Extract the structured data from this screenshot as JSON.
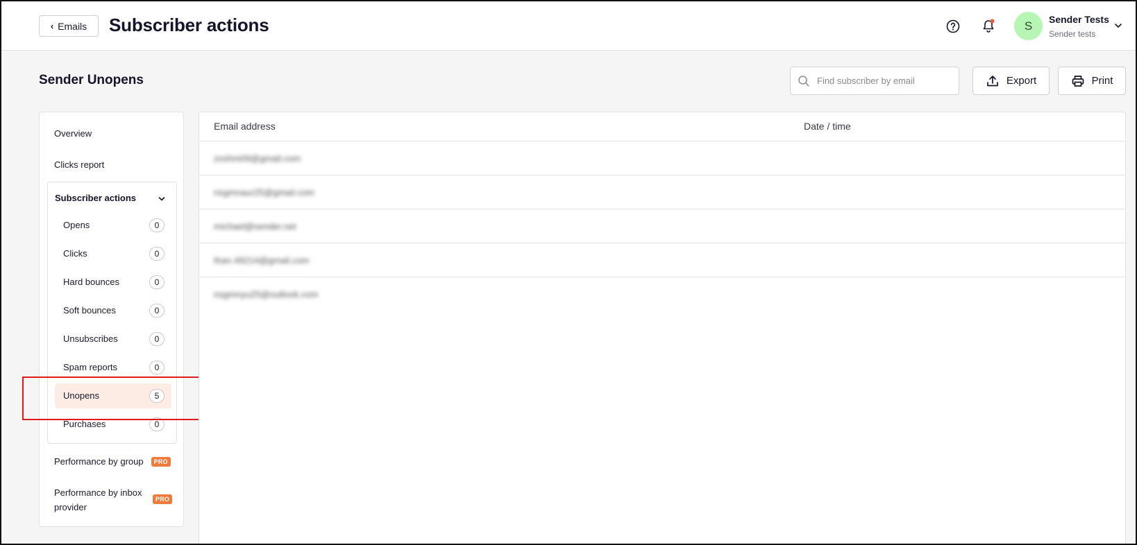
{
  "header": {
    "back_label": "Emails",
    "title": "Subscriber actions",
    "help_icon": "help-circle-icon",
    "notification_icon": "bell-icon",
    "notification_dot_color": "#f05a3a",
    "account": {
      "avatar_letter": "S",
      "name": "Sender Tests",
      "subtitle": "Sender tests"
    }
  },
  "section": {
    "title": "Sender Unopens",
    "search_placeholder": "Find subscriber by email",
    "export_label": "Export",
    "print_label": "Print"
  },
  "sidebar": {
    "overview": "Overview",
    "clicks_report": "Clicks report",
    "group_title": "Subscriber actions",
    "items": [
      {
        "label": "Opens",
        "count": "0"
      },
      {
        "label": "Clicks",
        "count": "0"
      },
      {
        "label": "Hard bounces",
        "count": "0"
      },
      {
        "label": "Soft bounces",
        "count": "0"
      },
      {
        "label": "Unsubscribes",
        "count": "0"
      },
      {
        "label": "Spam reports",
        "count": "0"
      },
      {
        "label": "Unopens",
        "count": "5",
        "active": true
      },
      {
        "label": "Purchases",
        "count": "0"
      }
    ],
    "performance_group": "Performance by group",
    "performance_inbox_line1": "Performance by inbox",
    "performance_inbox_line2": "provider",
    "pro_badge": "PRO"
  },
  "table": {
    "columns": [
      "Email address",
      "Date / time"
    ],
    "rows": [
      {
        "email": "zoshm09@gmail.com",
        "datetime": ""
      },
      {
        "email": "nsgmnaur25@gmail.com",
        "datetime": ""
      },
      {
        "email": "michael@sender.net",
        "datetime": ""
      },
      {
        "email": "than.49214@gmail.com",
        "datetime": ""
      },
      {
        "email": "nsgmnyu25@outlook.com",
        "datetime": ""
      }
    ]
  },
  "colors": {
    "accent": "#f07a3c",
    "active_bg": "#fdece4",
    "avatar_bg": "#b7f5b5",
    "highlight": "#e11b1b"
  }
}
